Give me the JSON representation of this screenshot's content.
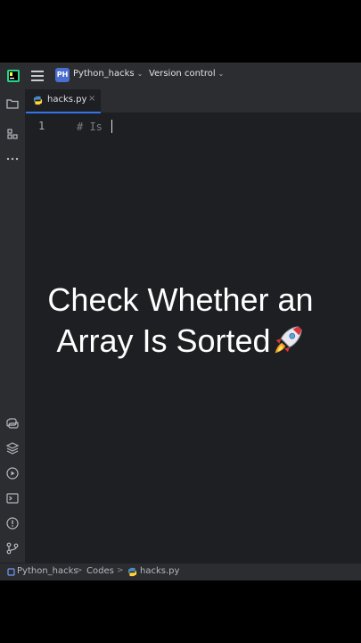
{
  "topbar": {
    "project_badge": "PH",
    "project_name": "Python_hacks",
    "vcs_label": "Version control",
    "chevron": "⌄"
  },
  "tab": {
    "label": "hacks.py",
    "close": "×"
  },
  "editor": {
    "line_number": "1",
    "code_text": "# Is "
  },
  "statusbar": {
    "breadcrumbs": [
      "Python_hacks",
      "Codes",
      "hacks.py"
    ],
    "separator": ">"
  },
  "overlay": {
    "line1": "Check Whether an",
    "line2": "Array Is Sorted"
  },
  "icons": {
    "left_toolbar_top": [
      "folder-icon",
      "structure-icon",
      "more-icon"
    ],
    "left_toolbar_bottom": [
      "python-console-icon",
      "layers-icon",
      "services-icon",
      "terminal-icon",
      "problems-icon",
      "git-icon"
    ],
    "emoji": "rocket-icon"
  },
  "colors": {
    "ide_bg": "#2b2d30",
    "editor_bg": "#1e1f22",
    "accent": "#3574f0",
    "project_badge": "#4a6fd0"
  }
}
